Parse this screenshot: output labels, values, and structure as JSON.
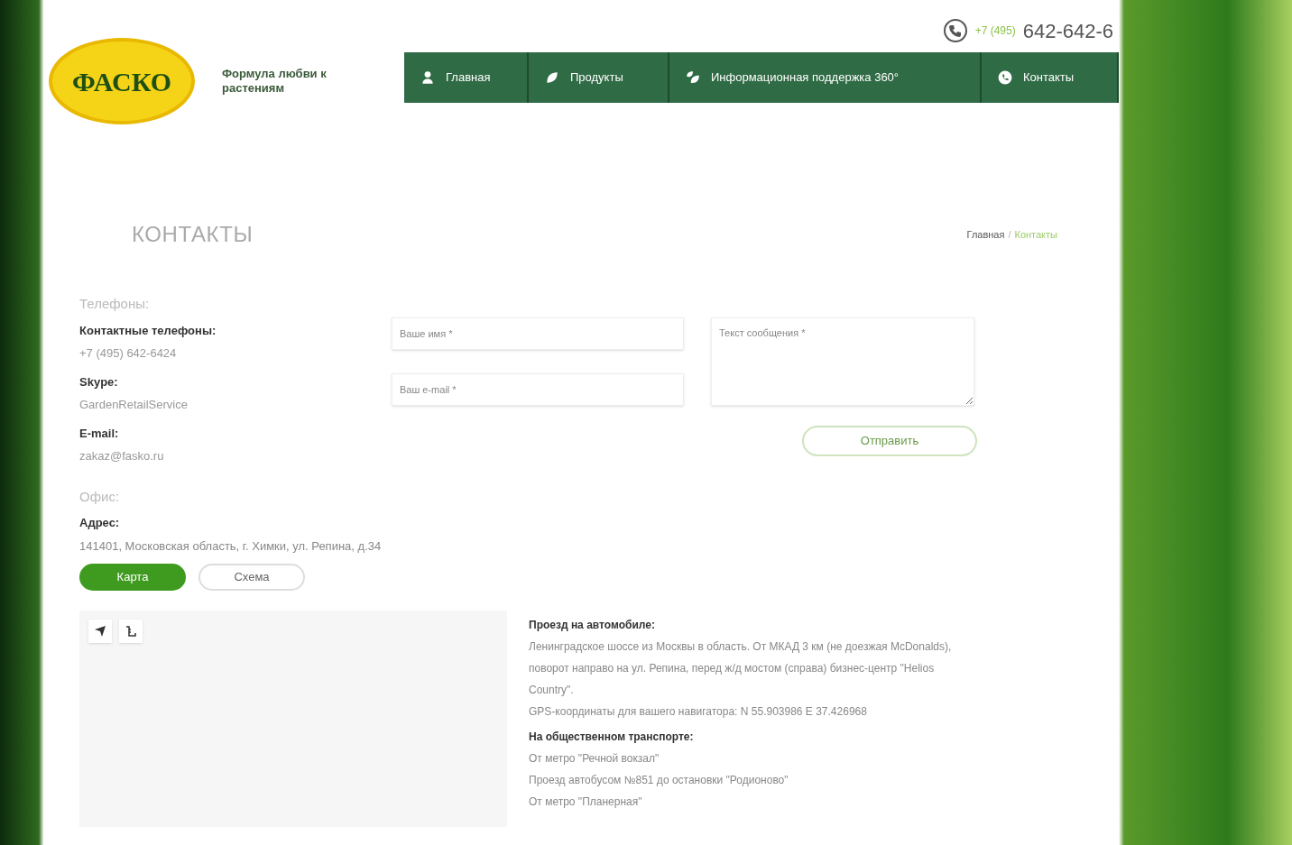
{
  "header": {
    "phone_code": "+7 (495)",
    "phone_number": "642-642-6",
    "logo": "ФАСКО",
    "tagline": "Формула любви к растениям"
  },
  "nav": [
    {
      "label": "Главная"
    },
    {
      "label": "Продукты"
    },
    {
      "label": "Информационная поддержка 360°"
    },
    {
      "label": "Контакты"
    }
  ],
  "page_title": "КОНТАКТЫ",
  "breadcrumb_separator": "/",
  "breadcrumbs": [
    {
      "label": "Главная",
      "current": false
    },
    {
      "label": "Контакты",
      "current": true
    }
  ],
  "contacts": {
    "phones_heading": "Телефоны:",
    "items": [
      {
        "label": "Контактные телефоны:",
        "value": "+7 (495) 642-6424"
      },
      {
        "label": "Skype:",
        "value": "GardenRetailService"
      },
      {
        "label": "E-mail:",
        "value": "zakaz@fasko.ru"
      }
    ],
    "office_heading": "Офис:",
    "address_label": "Адрес:",
    "address": "141401, Московская область, г. Химки, ул. Репина, д.34"
  },
  "map_tabs": [
    {
      "label": "Карта",
      "selected": true
    },
    {
      "label": "Схема",
      "selected": false
    }
  ],
  "form": {
    "name_placeholder": "Ваше имя *",
    "email_placeholder": "Ваш e-mail *",
    "message_placeholder": "Текст сообщения *",
    "submit": "Отправить"
  },
  "directions": [
    {
      "heading": "Проезд на автомобиле:",
      "lines": [
        "Ленинградское шоссе из Москвы в область. От МКАД 3 км (не доезжая McDonalds), поворот направо на ул. Репина, перед ж/д мостом (справа) бизнес-центр \"Helios Country\".",
        "GPS-координаты для вашего навигатора: N 55.903986 E 37.426968"
      ]
    },
    {
      "heading": "На общественном транспорте:",
      "lines": [
        "От метро \"Речной вокзал\"",
        "Проезд автобусом №851 до остановки \"Родионово\"",
        "От метро \"Планерная\""
      ]
    }
  ]
}
